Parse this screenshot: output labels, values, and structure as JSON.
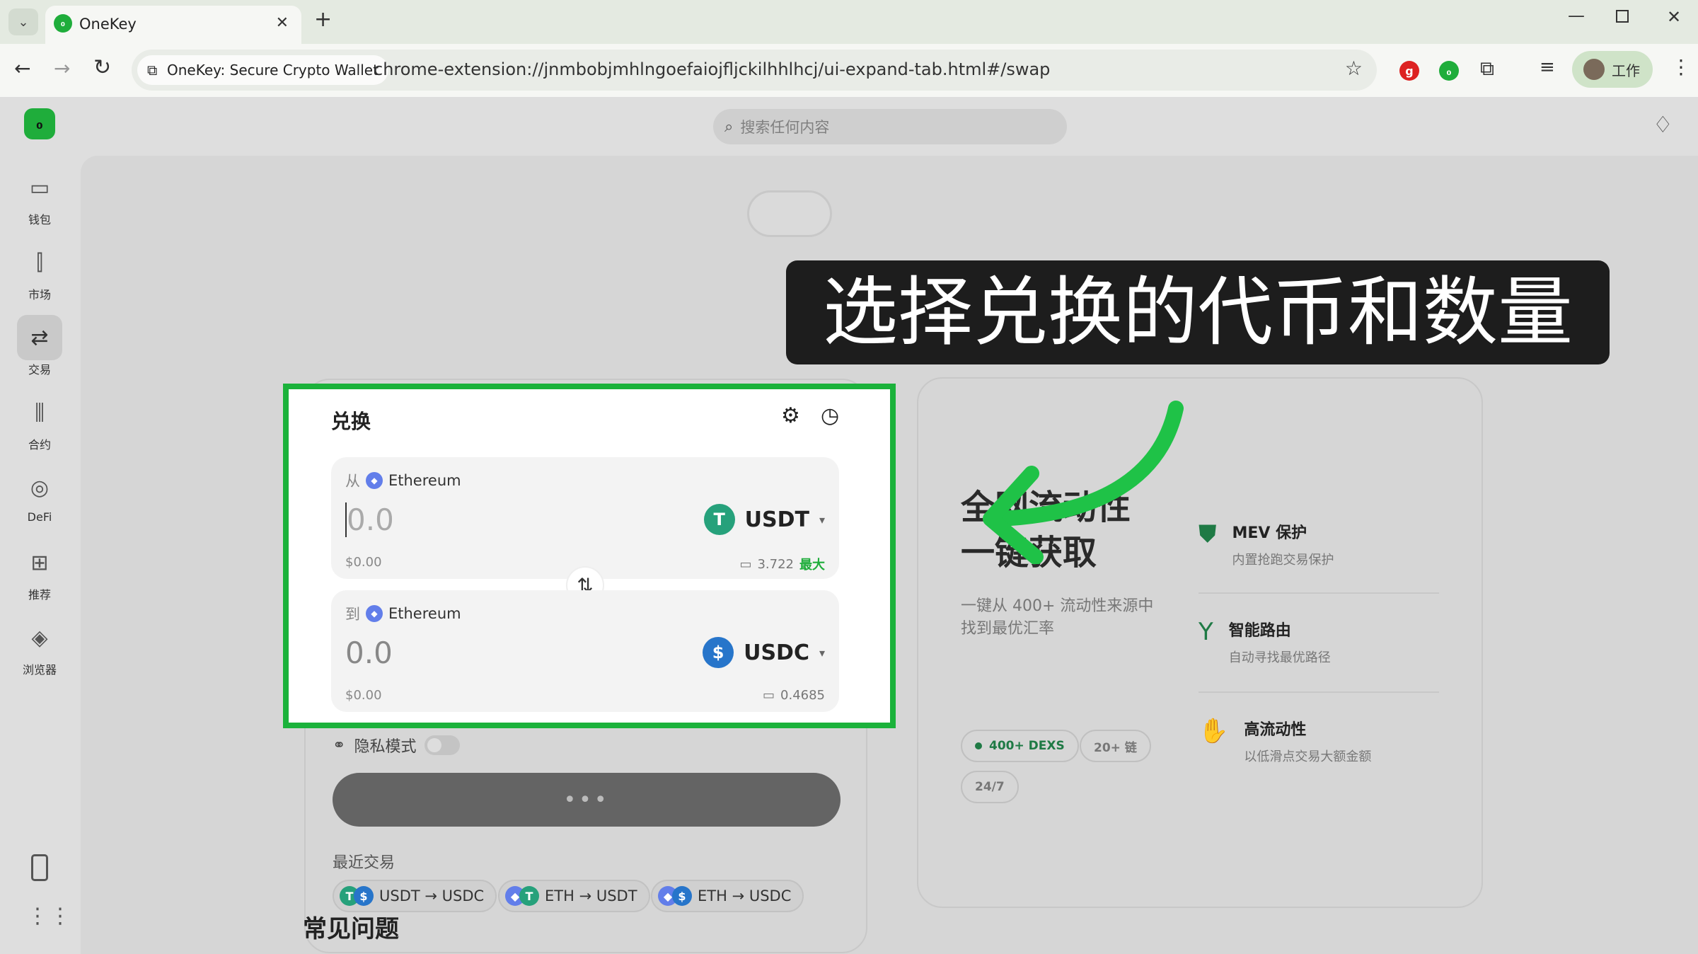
{
  "browser": {
    "tab_title": "OneKey",
    "new_tab": "+",
    "site_chip": "OneKey: Secure Crypto Wallet",
    "url": "chrome-extension://jnmbobjmhlngoefaiojfljckilhhlhcj/ui-expand-tab.html#/swap",
    "profile_label": "工作"
  },
  "app": {
    "search_placeholder": "搜索任何内容",
    "sidebar": [
      {
        "label": "钱包",
        "icon": "wallet-icon"
      },
      {
        "label": "市场",
        "icon": "market-icon"
      },
      {
        "label": "交易",
        "icon": "swap-icon",
        "active": true
      },
      {
        "label": "合约",
        "icon": "perps-icon"
      },
      {
        "label": "DeFi",
        "icon": "defi-icon"
      },
      {
        "label": "推荐",
        "icon": "gift-icon"
      },
      {
        "label": "浏览器",
        "icon": "compass-icon"
      }
    ]
  },
  "swap": {
    "title": "兑换",
    "from": {
      "direction": "从",
      "network": "Ethereum",
      "amount_placeholder": "0.0",
      "token": "USDT",
      "fiat": "$0.00",
      "balance": "3.722",
      "max_label": "最大"
    },
    "to": {
      "direction": "到",
      "network": "Ethereum",
      "amount": "0.0",
      "token": "USDC",
      "fiat": "$0.00",
      "balance": "0.4685"
    },
    "privacy_label": "隐私模式",
    "recent_label": "最近交易",
    "recent_pairs": [
      "USDT → USDC",
      "ETH → USDT",
      "ETH → USDC"
    ],
    "faq_title": "常见问题"
  },
  "info": {
    "headline_line1": "全网流动性",
    "headline_line2": "一键获取",
    "desc": "一键从 400+ 流动性来源中找到最优汇率",
    "features": [
      {
        "title": "MEV 保护",
        "desc": "内置抢跑交易保护"
      },
      {
        "title": "智能路由",
        "desc": "自动寻找最优路径"
      },
      {
        "title": "高流动性",
        "desc": "以低滑点交易大额金额"
      }
    ],
    "tags": [
      "400+ DEXS",
      "20+ 链",
      "24/7"
    ]
  },
  "overlay_caption": "选择兑换的代币和数量",
  "colors": {
    "highlight": "#1bb23b",
    "brand": "#1fad3b",
    "usdt": "#26a17b",
    "usdc": "#2775ca",
    "eth": "#627eea"
  }
}
